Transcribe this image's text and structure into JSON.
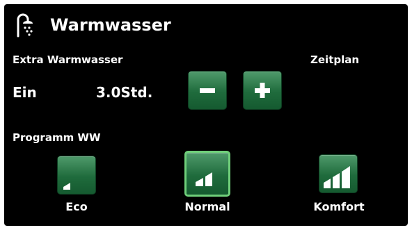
{
  "header": {
    "title": "Warmwasser",
    "icon": "shower-icon"
  },
  "extra": {
    "label": "Extra Warmwasser",
    "state": "Ein",
    "duration": "3.0Std.",
    "minus_icon": "minus-icon",
    "plus_icon": "plus-icon"
  },
  "schedule": {
    "label": "Zeitplan"
  },
  "program": {
    "label": "Programm WW",
    "selected": "Normal",
    "options": [
      {
        "label": "Eco",
        "icon": "signal-1-bar-icon"
      },
      {
        "label": "Normal",
        "icon": "signal-2-bars-icon"
      },
      {
        "label": "Komfort",
        "icon": "signal-3-bars-icon"
      }
    ]
  },
  "colors": {
    "accent": "#1f6b3c",
    "selected_border": "#6fcf7a",
    "background": "#000000",
    "text": "#ffffff"
  }
}
